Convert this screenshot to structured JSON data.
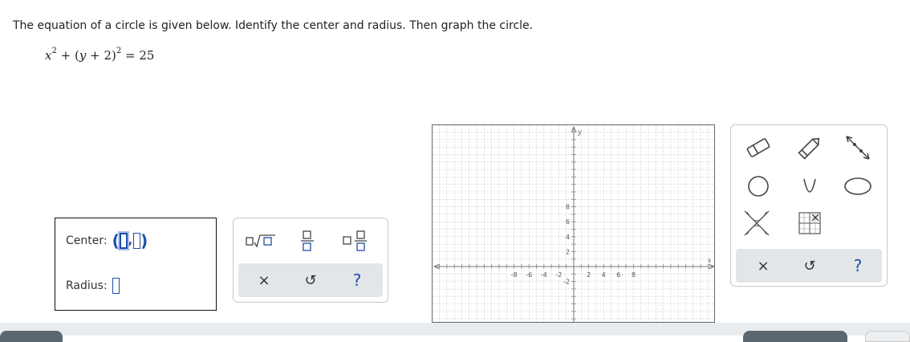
{
  "question": {
    "prompt": "The equation of a circle is given below. Identify the center and radius. Then graph the circle.",
    "equation": {
      "x": "x",
      "x_exp": "2",
      "plus1": "+",
      "open": "(",
      "y": "y",
      "plus2": "+",
      "two": "2",
      "close": ")",
      "y_exp": "2",
      "equals": "=",
      "rhs": "25"
    }
  },
  "answers": {
    "center_label": "Center:",
    "center_open": "(",
    "center_comma": ",",
    "center_close": ")",
    "radius_label": "Radius:"
  },
  "keypad": {
    "buttons": [
      "square-root-template-icon",
      "fraction-template-icon",
      "mixed-number-template-icon"
    ],
    "clear_label": "×",
    "undo_label": "↺",
    "help_label": "?"
  },
  "graph": {
    "x_axis_label": "x",
    "y_axis_label": "y",
    "x_tick_labels": [
      "-8",
      "-6",
      "-4",
      "-2",
      "2",
      "4",
      "6",
      "8"
    ],
    "y_tick_labels": [
      "8",
      "6",
      "4",
      "2",
      "-2"
    ]
  },
  "tools": {
    "items": [
      "eraser-icon",
      "pencil-icon",
      "line-arrow-icon",
      "circle-icon",
      "parabola-icon",
      "ellipse-icon",
      "no-solution-icon",
      "grid-table-icon"
    ],
    "clear_label": "×",
    "undo_label": "↺",
    "help_label": "?"
  },
  "colors": {
    "accent": "#1e4fa8",
    "panel_bar": "#e3e6e8",
    "grid": "#c6c6c6"
  }
}
